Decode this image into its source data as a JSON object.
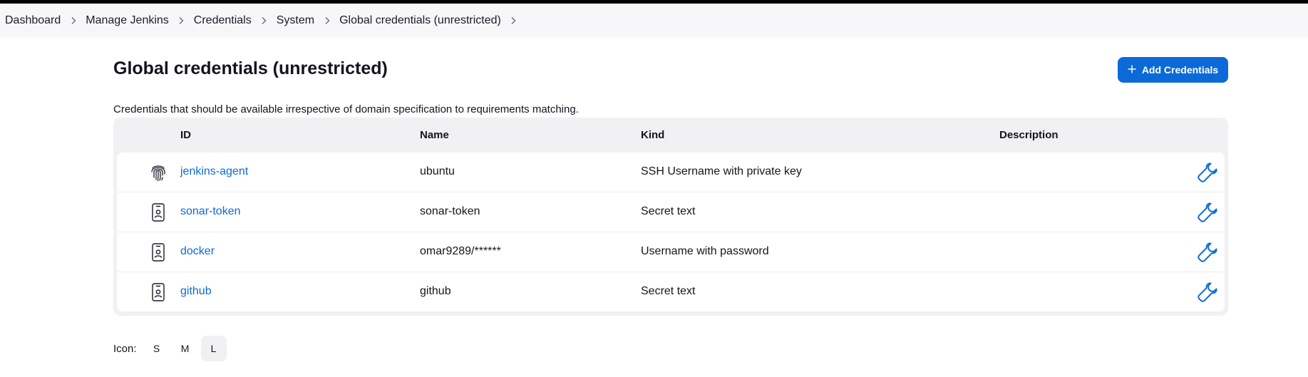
{
  "breadcrumbs": [
    {
      "label": "Dashboard"
    },
    {
      "label": "Manage Jenkins"
    },
    {
      "label": "Credentials"
    },
    {
      "label": "System"
    },
    {
      "label": "Global credentials (unrestricted)"
    }
  ],
  "page": {
    "title": "Global credentials (unrestricted)",
    "add_button_label": "Add Credentials",
    "description": "Credentials that should be available irrespective of domain specification to requirements matching."
  },
  "table": {
    "headers": {
      "id": "ID",
      "name": "Name",
      "kind": "Kind",
      "description": "Description"
    },
    "rows": [
      {
        "icon": "fingerprint-icon",
        "id": "jenkins-agent",
        "name": "ubuntu",
        "kind": "SSH Username with private key",
        "description": ""
      },
      {
        "icon": "id-card-icon",
        "id": "sonar-token",
        "name": "sonar-token",
        "kind": "Secret text",
        "description": ""
      },
      {
        "icon": "id-card-icon",
        "id": "docker",
        "name": "omar9289/******",
        "kind": "Username with password",
        "description": ""
      },
      {
        "icon": "id-card-icon",
        "id": "github",
        "name": "github",
        "kind": "Secret text",
        "description": ""
      }
    ]
  },
  "icon_size": {
    "label": "Icon:",
    "options": [
      "S",
      "M",
      "L"
    ],
    "selected": "L"
  },
  "colors": {
    "accent": "#0b6ad8",
    "topbar": "#000000",
    "breadcrumb_bg": "#f7f7f9"
  }
}
